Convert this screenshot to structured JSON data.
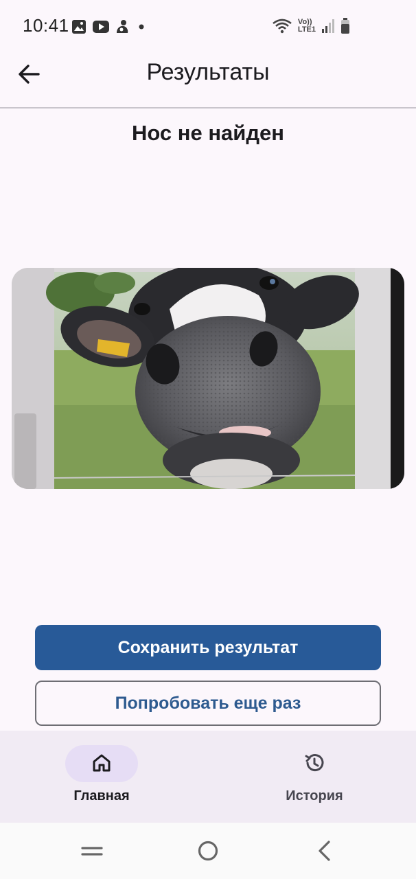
{
  "status_bar": {
    "time": "10:41",
    "left_icons": [
      "image-icon",
      "youtube-icon",
      "notification-app-icon",
      "dot-icon"
    ],
    "right_icons": [
      "wifi-icon",
      "volte-icon",
      "signal-icon",
      "battery-icon"
    ],
    "volte_label_top": "Vo))",
    "volte_label_bottom": "LTE1"
  },
  "app_bar": {
    "title": "Результаты",
    "back_icon": "arrow-back-icon"
  },
  "result": {
    "heading": "Нос не найден",
    "photo_subject": "cow-muzzle-photo"
  },
  "actions": {
    "save_label": "Сохранить результат",
    "retry_label": "Попробовать еще раз"
  },
  "bottom_nav": {
    "items": [
      {
        "label": "Главная",
        "icon": "home-icon",
        "active": true
      },
      {
        "label": "История",
        "icon": "history-icon",
        "active": false
      }
    ]
  },
  "system_nav": {
    "buttons": [
      "recents-icon",
      "home-circle-icon",
      "back-chevron-icon"
    ]
  },
  "colors": {
    "background": "#fcf7fc",
    "primary_button": "#285a98",
    "outline_text": "#2d5a8f",
    "nav_background": "#f1ebf4",
    "active_pill": "#e6ddf5"
  }
}
